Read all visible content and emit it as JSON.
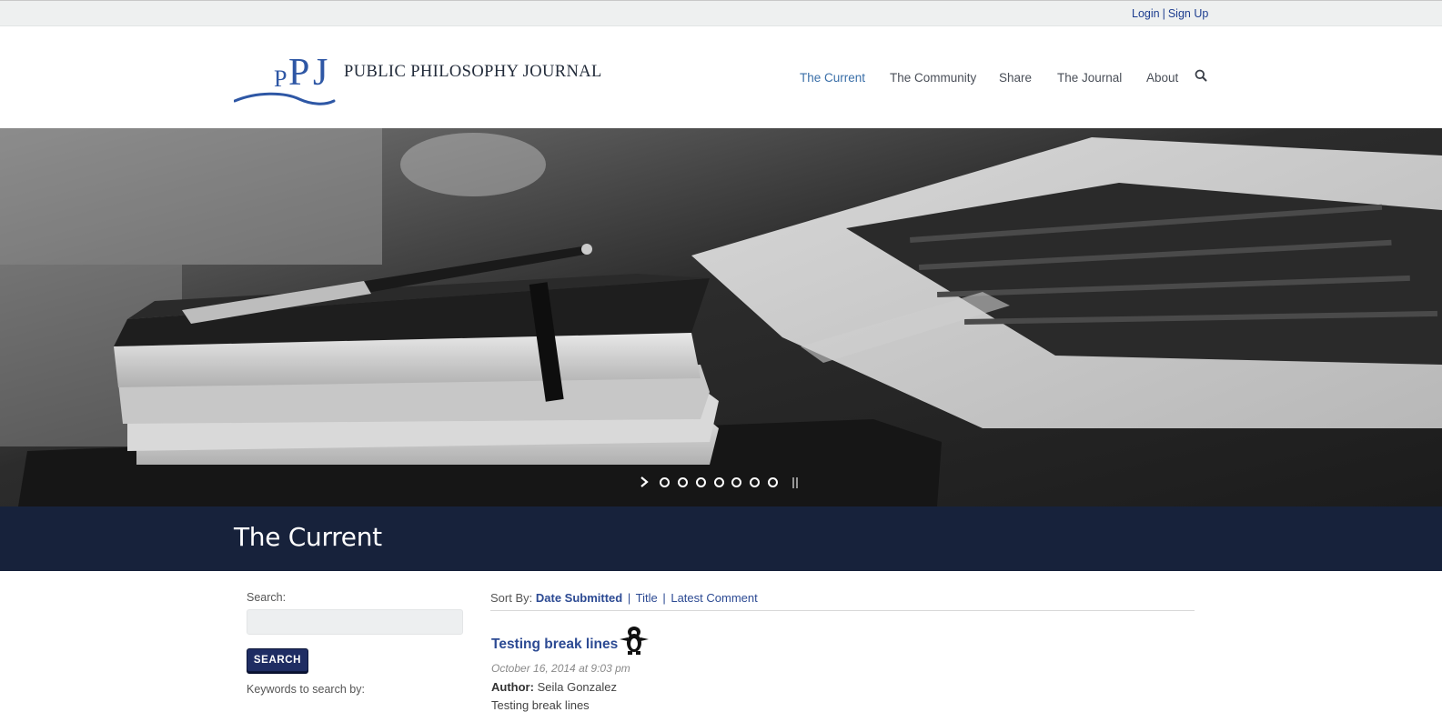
{
  "topbar": {
    "login": "Login",
    "separator": "|",
    "signup": "Sign Up"
  },
  "logo": {
    "mark_letters": "PPJ",
    "text": "PUBLIC PHILOSOPHY JOURNAL",
    "color": "#2e57a5"
  },
  "nav": {
    "items": [
      {
        "label": "The Current",
        "active": true
      },
      {
        "label": "The Community",
        "active": false
      },
      {
        "label": "Share",
        "active": false
      },
      {
        "label": "The Journal",
        "active": false
      },
      {
        "label": "About",
        "active": false
      }
    ],
    "search_icon": "search-icon"
  },
  "hero": {
    "slide_count": 7,
    "active_slide": 1,
    "next_icon": "chevron-right-icon",
    "pause_icon": "pause-icon"
  },
  "banner": {
    "title": "The Current",
    "background": "#17223b"
  },
  "sidebar": {
    "search_label": "Search:",
    "search_placeholder": "",
    "search_button": "SEARCH",
    "keywords_label": "Keywords to search by:"
  },
  "sort": {
    "prefix": "Sort By:",
    "options": [
      {
        "label": "Date Submitted",
        "active": true
      },
      {
        "label": "Title",
        "active": false
      },
      {
        "label": "Latest Comment",
        "active": false
      }
    ],
    "separator": "|"
  },
  "posts": [
    {
      "title": "Testing break lines",
      "date": "October 16, 2014 at 9:03 pm",
      "author_label": "Author:",
      "author": "Seila Gonzalez",
      "excerpt": "Testing break lines"
    }
  ],
  "colors": {
    "link": "#2c4a93",
    "nav_active": "#3a6fa8",
    "button": "#1f2d63"
  }
}
